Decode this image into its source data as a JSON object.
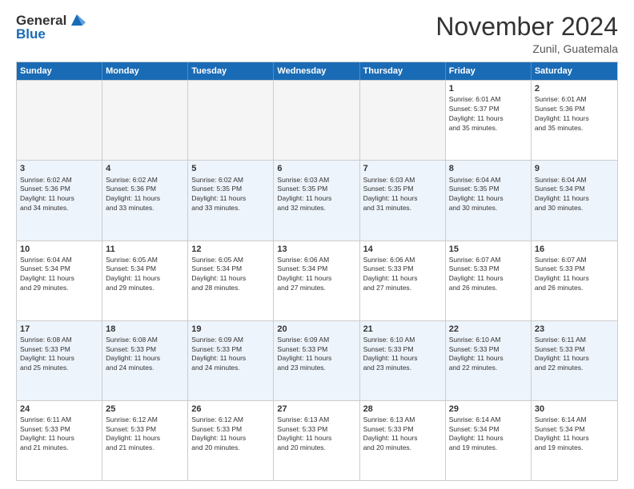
{
  "logo": {
    "general": "General",
    "blue": "Blue"
  },
  "title": "November 2024",
  "location": "Zunil, Guatemala",
  "days": [
    "Sunday",
    "Monday",
    "Tuesday",
    "Wednesday",
    "Thursday",
    "Friday",
    "Saturday"
  ],
  "weeks": [
    [
      {
        "day": "",
        "content": "",
        "empty": true
      },
      {
        "day": "",
        "content": "",
        "empty": true
      },
      {
        "day": "",
        "content": "",
        "empty": true
      },
      {
        "day": "",
        "content": "",
        "empty": true
      },
      {
        "day": "",
        "content": "",
        "empty": true
      },
      {
        "day": "1",
        "content": "Sunrise: 6:01 AM\nSunset: 5:37 PM\nDaylight: 11 hours\nand 35 minutes.",
        "empty": false
      },
      {
        "day": "2",
        "content": "Sunrise: 6:01 AM\nSunset: 5:36 PM\nDaylight: 11 hours\nand 35 minutes.",
        "empty": false
      }
    ],
    [
      {
        "day": "3",
        "content": "Sunrise: 6:02 AM\nSunset: 5:36 PM\nDaylight: 11 hours\nand 34 minutes.",
        "empty": false
      },
      {
        "day": "4",
        "content": "Sunrise: 6:02 AM\nSunset: 5:36 PM\nDaylight: 11 hours\nand 33 minutes.",
        "empty": false
      },
      {
        "day": "5",
        "content": "Sunrise: 6:02 AM\nSunset: 5:35 PM\nDaylight: 11 hours\nand 33 minutes.",
        "empty": false
      },
      {
        "day": "6",
        "content": "Sunrise: 6:03 AM\nSunset: 5:35 PM\nDaylight: 11 hours\nand 32 minutes.",
        "empty": false
      },
      {
        "day": "7",
        "content": "Sunrise: 6:03 AM\nSunset: 5:35 PM\nDaylight: 11 hours\nand 31 minutes.",
        "empty": false
      },
      {
        "day": "8",
        "content": "Sunrise: 6:04 AM\nSunset: 5:35 PM\nDaylight: 11 hours\nand 30 minutes.",
        "empty": false
      },
      {
        "day": "9",
        "content": "Sunrise: 6:04 AM\nSunset: 5:34 PM\nDaylight: 11 hours\nand 30 minutes.",
        "empty": false
      }
    ],
    [
      {
        "day": "10",
        "content": "Sunrise: 6:04 AM\nSunset: 5:34 PM\nDaylight: 11 hours\nand 29 minutes.",
        "empty": false
      },
      {
        "day": "11",
        "content": "Sunrise: 6:05 AM\nSunset: 5:34 PM\nDaylight: 11 hours\nand 29 minutes.",
        "empty": false
      },
      {
        "day": "12",
        "content": "Sunrise: 6:05 AM\nSunset: 5:34 PM\nDaylight: 11 hours\nand 28 minutes.",
        "empty": false
      },
      {
        "day": "13",
        "content": "Sunrise: 6:06 AM\nSunset: 5:34 PM\nDaylight: 11 hours\nand 27 minutes.",
        "empty": false
      },
      {
        "day": "14",
        "content": "Sunrise: 6:06 AM\nSunset: 5:33 PM\nDaylight: 11 hours\nand 27 minutes.",
        "empty": false
      },
      {
        "day": "15",
        "content": "Sunrise: 6:07 AM\nSunset: 5:33 PM\nDaylight: 11 hours\nand 26 minutes.",
        "empty": false
      },
      {
        "day": "16",
        "content": "Sunrise: 6:07 AM\nSunset: 5:33 PM\nDaylight: 11 hours\nand 26 minutes.",
        "empty": false
      }
    ],
    [
      {
        "day": "17",
        "content": "Sunrise: 6:08 AM\nSunset: 5:33 PM\nDaylight: 11 hours\nand 25 minutes.",
        "empty": false
      },
      {
        "day": "18",
        "content": "Sunrise: 6:08 AM\nSunset: 5:33 PM\nDaylight: 11 hours\nand 24 minutes.",
        "empty": false
      },
      {
        "day": "19",
        "content": "Sunrise: 6:09 AM\nSunset: 5:33 PM\nDaylight: 11 hours\nand 24 minutes.",
        "empty": false
      },
      {
        "day": "20",
        "content": "Sunrise: 6:09 AM\nSunset: 5:33 PM\nDaylight: 11 hours\nand 23 minutes.",
        "empty": false
      },
      {
        "day": "21",
        "content": "Sunrise: 6:10 AM\nSunset: 5:33 PM\nDaylight: 11 hours\nand 23 minutes.",
        "empty": false
      },
      {
        "day": "22",
        "content": "Sunrise: 6:10 AM\nSunset: 5:33 PM\nDaylight: 11 hours\nand 22 minutes.",
        "empty": false
      },
      {
        "day": "23",
        "content": "Sunrise: 6:11 AM\nSunset: 5:33 PM\nDaylight: 11 hours\nand 22 minutes.",
        "empty": false
      }
    ],
    [
      {
        "day": "24",
        "content": "Sunrise: 6:11 AM\nSunset: 5:33 PM\nDaylight: 11 hours\nand 21 minutes.",
        "empty": false
      },
      {
        "day": "25",
        "content": "Sunrise: 6:12 AM\nSunset: 5:33 PM\nDaylight: 11 hours\nand 21 minutes.",
        "empty": false
      },
      {
        "day": "26",
        "content": "Sunrise: 6:12 AM\nSunset: 5:33 PM\nDaylight: 11 hours\nand 20 minutes.",
        "empty": false
      },
      {
        "day": "27",
        "content": "Sunrise: 6:13 AM\nSunset: 5:33 PM\nDaylight: 11 hours\nand 20 minutes.",
        "empty": false
      },
      {
        "day": "28",
        "content": "Sunrise: 6:13 AM\nSunset: 5:33 PM\nDaylight: 11 hours\nand 20 minutes.",
        "empty": false
      },
      {
        "day": "29",
        "content": "Sunrise: 6:14 AM\nSunset: 5:34 PM\nDaylight: 11 hours\nand 19 minutes.",
        "empty": false
      },
      {
        "day": "30",
        "content": "Sunrise: 6:14 AM\nSunset: 5:34 PM\nDaylight: 11 hours\nand 19 minutes.",
        "empty": false
      }
    ]
  ]
}
